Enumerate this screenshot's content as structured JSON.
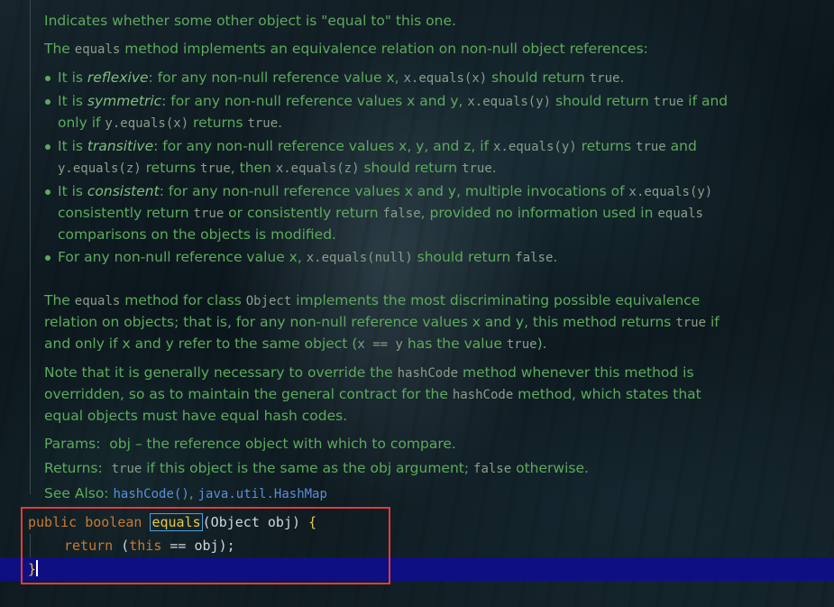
{
  "doc": {
    "p1": "Indicates whether some other object is \"equal to\" this one.",
    "p2": {
      "a": "The ",
      "code1": "equals",
      "b": " method implements an equivalence relation on non-null object references:"
    },
    "items": [
      {
        "a": "It is ",
        "em": "reflexive",
        "b": ": for any non-null reference value x, ",
        "c1": "x.equals(x)",
        "d": " should return ",
        "c2": "true",
        "e": "."
      },
      {
        "a": "It is ",
        "em": "symmetric",
        "b": ": for any non-null reference values x and y, ",
        "c1": "x.equals(y)",
        "d": " should return ",
        "c2": "true",
        "e": " if and only if ",
        "c3": "y.equals(x)",
        "f": " returns ",
        "c4": "true",
        "g": "."
      },
      {
        "a": "It is ",
        "em": "transitive",
        "b": ": for any non-null reference values x, y, and z, if ",
        "c1": "x.equals(y)",
        "d": " returns ",
        "c2": "true",
        "e": " and ",
        "c3": "y.equals(z)",
        "f": " returns ",
        "c4": "true",
        "g": ", then ",
        "c5": "x.equals(z)",
        "h": " should return ",
        "c6": "true",
        "i": "."
      },
      {
        "a": "It is ",
        "em": "consistent",
        "b": ": for any non-null reference values x and y, multiple invocations of ",
        "c1": "x.equals(y)",
        "d": " consistently return ",
        "c2": "true",
        "e": " or consistently return ",
        "c3": "false",
        "f": ", provided no information used in ",
        "c4": "equals",
        "g": " comparisons on the objects is modified."
      },
      {
        "a": "For any non-null reference value x, ",
        "c1": "x.equals(null)",
        "b": " should return ",
        "c2": "false",
        "c": "."
      }
    ],
    "p3": {
      "a": "The ",
      "c1": "equals",
      "b": " method for class ",
      "c2": "Object",
      "c": " implements the most discriminating possible equivalence relation on objects; that is, for any non-null reference values x and y, this method returns ",
      "c3": "true",
      "d": " if and only if x and y refer to the same object (",
      "c4": "x == y",
      "e": " has the value ",
      "c5": "true",
      "f": ")."
    },
    "p4": {
      "a": "Note that it is generally necessary to override the ",
      "c1": "hashCode",
      "b": " method whenever this method is overridden, so as to maintain the general contract for the ",
      "c2": "hashCode",
      "c": " method, which states that equal objects must have equal hash codes."
    },
    "params": {
      "label": "Params:",
      "text": "obj – the reference object with which to compare."
    },
    "returns": {
      "label": "Returns:",
      "c1": "true",
      "a": " if this object is the same as the obj argument; ",
      "c2": "false",
      "b": " otherwise."
    },
    "see_also": {
      "label": "See Also:",
      "link1": "hashCode()",
      "sep": ", ",
      "link2": "java.util.HashMap"
    }
  },
  "code": {
    "line1": {
      "kw1": "public",
      "kw2": "boolean",
      "method": "equals",
      "params": "(Object obj)",
      "brace": "{"
    },
    "line2": {
      "kw_return": "return",
      "open": "(",
      "kw_this": "this",
      "rest": " == obj);"
    },
    "line3": {
      "brace": "}"
    }
  },
  "colors": {
    "doc_text": "#5cab5c",
    "keyword": "#cc7832",
    "link": "#5a8fd6",
    "current_line": "#0f0f84",
    "highlight_box": "#e03c3c"
  }
}
